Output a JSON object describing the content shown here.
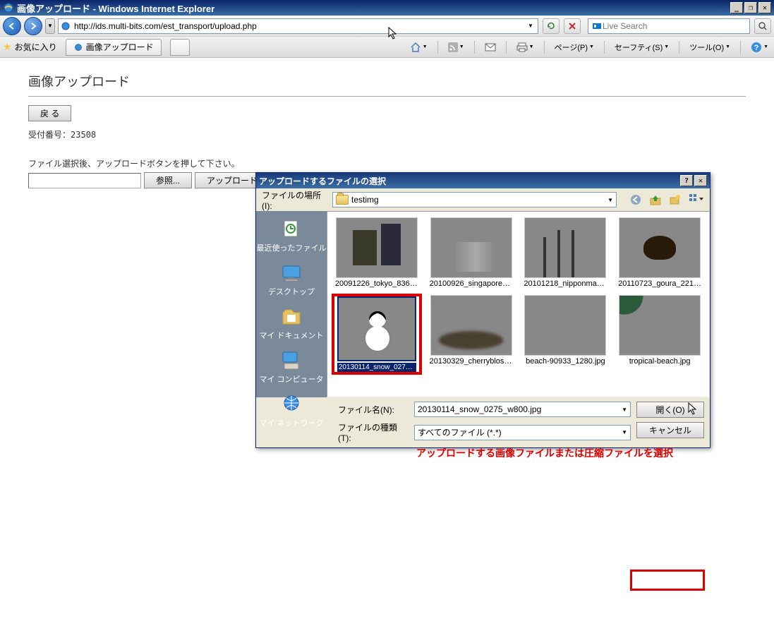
{
  "window": {
    "title": "画像アップロード - Windows Internet Explorer",
    "min": "_",
    "max": "□",
    "restore": "❐",
    "close": "✕"
  },
  "nav": {
    "url": "http://ids.multi-bits.com/est_transport/upload.php",
    "search_placeholder": "Live Search"
  },
  "favbar": {
    "favorites": "お気に入り",
    "tab_title": "画像アップロード",
    "menu_page": "ページ(P)",
    "menu_safety": "セーフティ(S)",
    "menu_tools": "ツール(O)"
  },
  "page": {
    "heading": "画像アップロード",
    "back_btn": "戻 る",
    "receipt_label": "受付番号：",
    "receipt_no": "23508",
    "instruction": "ファイル選択後、アップロードボタンを押して下さい。",
    "browse_btn": "参照...",
    "upload_btn": "アップロード"
  },
  "dialog": {
    "title": "アップロードするファイルの選択",
    "help": "?",
    "close": "✕",
    "location_label": "ファイルの場所(I):",
    "location_value": "testimg",
    "places": {
      "recent": "最近使ったファイル",
      "desktop": "デスクトップ",
      "mydocs": "マイ ドキュメント",
      "mycomp": "マイ コンピュータ",
      "mynet": "マイ ネットワーク"
    },
    "files": [
      {
        "name": "20091226_tokyo_8363_...",
        "scene": "scene-tokyo"
      },
      {
        "name": "20100926_singapore_0...",
        "scene": "scene-sg"
      },
      {
        "name": "20101218_nipponmaru_...",
        "scene": "scene-ship"
      },
      {
        "name": "20110723_goura_2216_...",
        "scene": "scene-beetle"
      },
      {
        "name": "20130114_snow_0275_w800.jpg",
        "scene": "scene-snow",
        "selected": true
      },
      {
        "name": "20130329_cherrybloss...",
        "scene": "scene-cherry"
      },
      {
        "name": "beach-90933_1280.jpg",
        "scene": "scene-beach1"
      },
      {
        "name": "tropical-beach.jpg",
        "scene": "scene-beach2"
      }
    ],
    "filename_label": "ファイル名(N):",
    "filename_value": "20130114_snow_0275_w800.jpg",
    "filetype_label": "ファイルの種類(T):",
    "filetype_value": "すべてのファイル (*.*)",
    "open_btn": "開く(O)",
    "cancel_btn": "キャンセル"
  },
  "annotation": "アップロードする画像ファイルまたは圧縮ファイルを選択"
}
